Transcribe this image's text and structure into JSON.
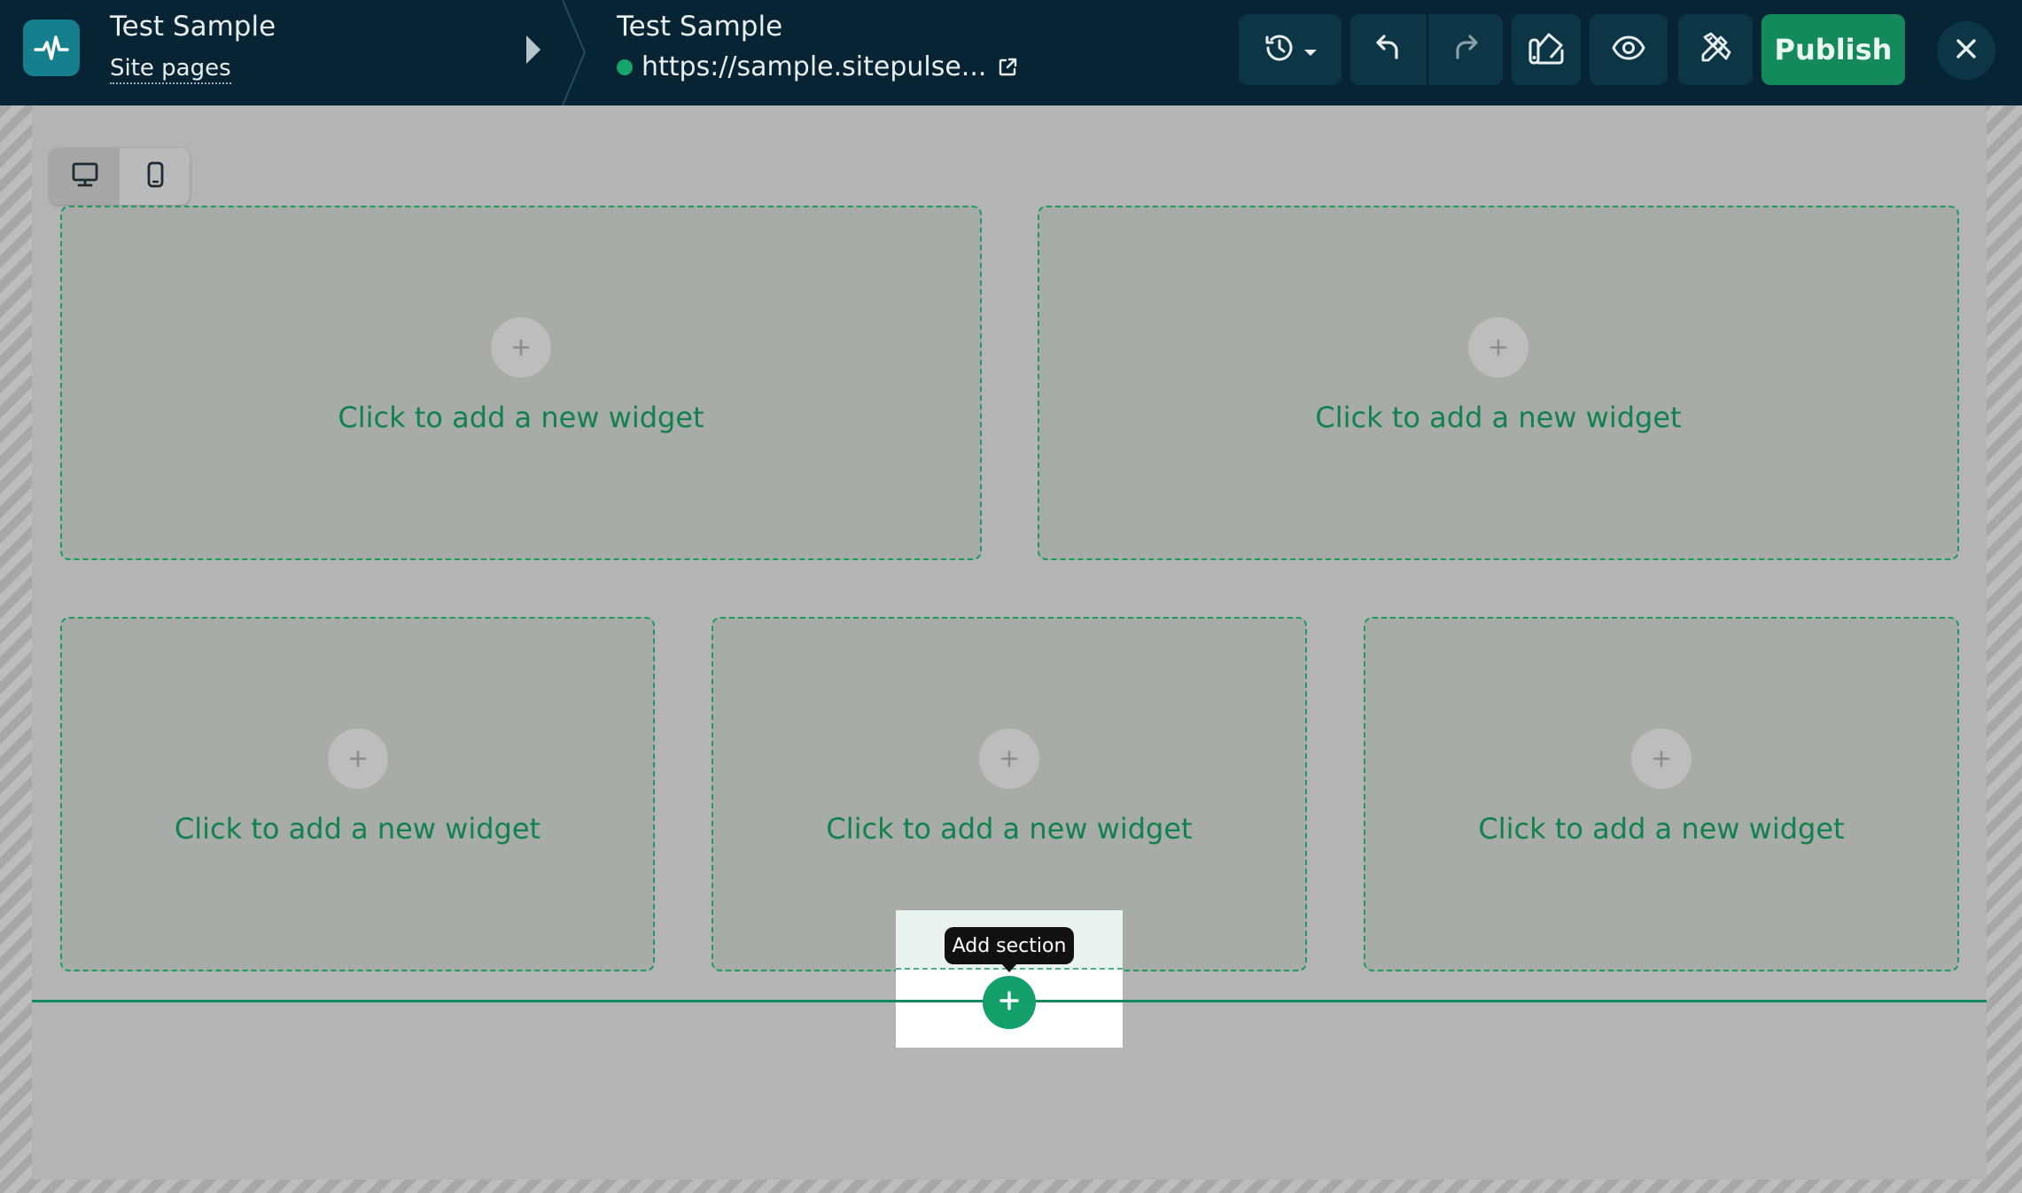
{
  "header": {
    "site_title": "Test Sample",
    "site_pages_link": "Site pages",
    "page_title": "Test Sample",
    "page_url": "https://sample.sitepulse...",
    "publish_label": "Publish"
  },
  "icons": {
    "logo": "pulse-logo-icon",
    "history": "history-icon",
    "undo": "undo-icon",
    "redo": "redo-icon",
    "style": "paint-bucket-icon",
    "preview": "eye-icon",
    "tools": "pencil-ruler-icon",
    "close": "close-icon",
    "desktop": "desktop-icon",
    "mobile": "mobile-icon",
    "external_link": "external-link-icon"
  },
  "colors": {
    "topbar": "#062433",
    "accent": "#148a5c",
    "widget_text": "#12804f",
    "status_online": "#16a36b"
  },
  "canvas": {
    "row1": [
      {
        "label": "Click to add a new widget"
      },
      {
        "label": "Click to add a new widget"
      }
    ],
    "row2": [
      {
        "label": "Click to add a new widget"
      },
      {
        "label": "Click to add a new widget"
      },
      {
        "label": "Click to add a new widget"
      }
    ],
    "add_section_tooltip": "Add section"
  }
}
